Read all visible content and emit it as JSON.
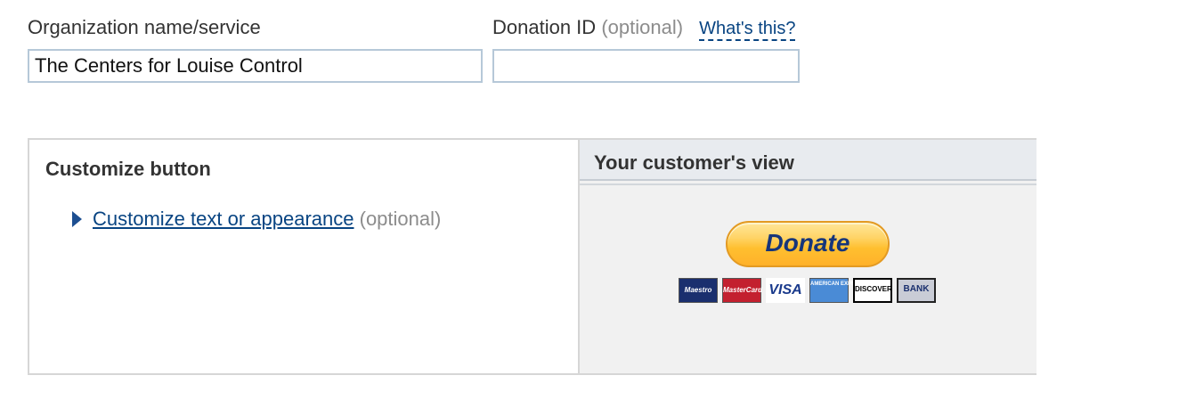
{
  "org_field": {
    "label": "Organization name/service",
    "value": "The Centers for Louise Control"
  },
  "donation_id_field": {
    "label": "Donation ID",
    "optional": "(optional)",
    "help_link": "What's this?",
    "value": ""
  },
  "customize_panel": {
    "title": "Customize button",
    "toggle_link": "Customize text or appearance",
    "toggle_optional": "(optional)"
  },
  "preview_panel": {
    "title": "Your customer's view",
    "donate_label": "Donate",
    "cards": [
      {
        "name": "Maestro",
        "text": "Maestro"
      },
      {
        "name": "MasterCard",
        "text": "MasterCard"
      },
      {
        "name": "Visa",
        "text": "VISA"
      },
      {
        "name": "American Express",
        "text": "AMERICAN EXPRESS"
      },
      {
        "name": "Discover",
        "text": "DISCOVER"
      },
      {
        "name": "Bank",
        "text": "BANK"
      }
    ]
  },
  "colors": {
    "link": "#084482",
    "input_border": "#b6c8d8",
    "donate_gold": "#ffc439",
    "donate_text": "#16357a",
    "optional_gray": "#8c8c8c"
  }
}
